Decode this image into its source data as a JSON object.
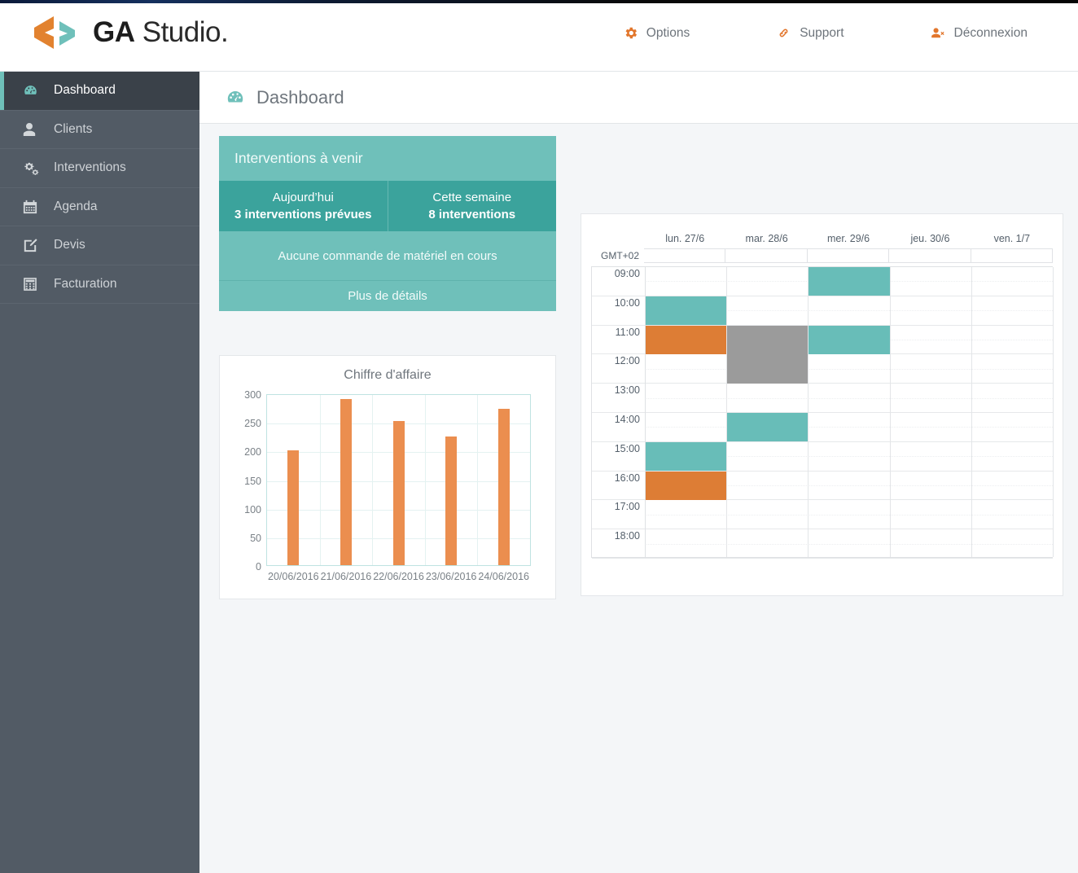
{
  "brand": {
    "name_bold": "GA",
    "name_light": " Studio.",
    "logo_icon": "double-chevron-logo",
    "orange": "#e2762c",
    "teal": "#6fc0ba"
  },
  "header": {
    "nav": [
      {
        "label": "Options",
        "icon": "gear-icon"
      },
      {
        "label": "Support",
        "icon": "link-chain-icon"
      },
      {
        "label": "Déconnexion",
        "icon": "user-times-icon"
      }
    ]
  },
  "sidebar": {
    "items": [
      {
        "label": "Dashboard",
        "icon": "dashboard-icon",
        "active": true
      },
      {
        "label": "Clients",
        "icon": "user-icon",
        "active": false
      },
      {
        "label": "Interventions",
        "icon": "cogs-icon",
        "active": false
      },
      {
        "label": "Agenda",
        "icon": "calendar-icon",
        "active": false
      },
      {
        "label": "Devis",
        "icon": "edit-icon",
        "active": false
      },
      {
        "label": "Facturation",
        "icon": "calculator-icon",
        "active": false
      }
    ]
  },
  "page": {
    "title": "Dashboard",
    "icon": "dashboard-icon"
  },
  "interventions_panel": {
    "title": "Interventions à venir",
    "stats": [
      {
        "label": "Aujourd’hui",
        "value": "3 interventions prévues"
      },
      {
        "label": "Cette semaine",
        "value": "8 interventions"
      }
    ],
    "message": "Aucune commande de matériel en cours",
    "more_label": "Plus de détails"
  },
  "chart_data": {
    "type": "bar",
    "title": "Chiffre d'affaire",
    "categories": [
      "20/06/2016",
      "21/06/2016",
      "22/06/2016",
      "23/06/2016",
      "24/06/2016"
    ],
    "values": [
      200,
      290,
      251,
      224,
      273
    ],
    "xlabel": "",
    "ylabel": "",
    "ylim": [
      0,
      300
    ],
    "yticks": [
      0,
      50,
      100,
      150,
      200,
      250,
      300
    ],
    "grid": true,
    "legend": false,
    "bar_color": "#eb8e4f"
  },
  "calendar": {
    "timezone_label": "GMT+02",
    "days": [
      "lun. 27/6",
      "mar. 28/6",
      "mer. 29/6",
      "jeu. 30/6",
      "ven. 1/7"
    ],
    "hours": [
      "09:00",
      "10:00",
      "11:00",
      "12:00",
      "13:00",
      "14:00",
      "15:00",
      "16:00",
      "17:00",
      "18:00"
    ],
    "events": [
      {
        "day": 2,
        "start_hour": 9,
        "duration_hours": 1,
        "color": "#68bdb8",
        "type": "intervention"
      },
      {
        "day": 0,
        "start_hour": 10,
        "duration_hours": 1,
        "color": "#68bdb8",
        "type": "intervention"
      },
      {
        "day": 0,
        "start_hour": 11,
        "duration_hours": 1,
        "color": "#dd7d35",
        "type": "urgent"
      },
      {
        "day": 1,
        "start_hour": 11,
        "duration_hours": 2,
        "color": "#9b9b9b",
        "type": "indisponible"
      },
      {
        "day": 2,
        "start_hour": 11,
        "duration_hours": 1,
        "color": "#68bdb8",
        "type": "intervention"
      },
      {
        "day": 1,
        "start_hour": 14,
        "duration_hours": 1,
        "color": "#68bdb8",
        "type": "intervention"
      },
      {
        "day": 0,
        "start_hour": 15,
        "duration_hours": 1,
        "color": "#68bdb8",
        "type": "intervention"
      },
      {
        "day": 0,
        "start_hour": 16,
        "duration_hours": 1,
        "color": "#dd7d35",
        "type": "urgent"
      }
    ]
  }
}
